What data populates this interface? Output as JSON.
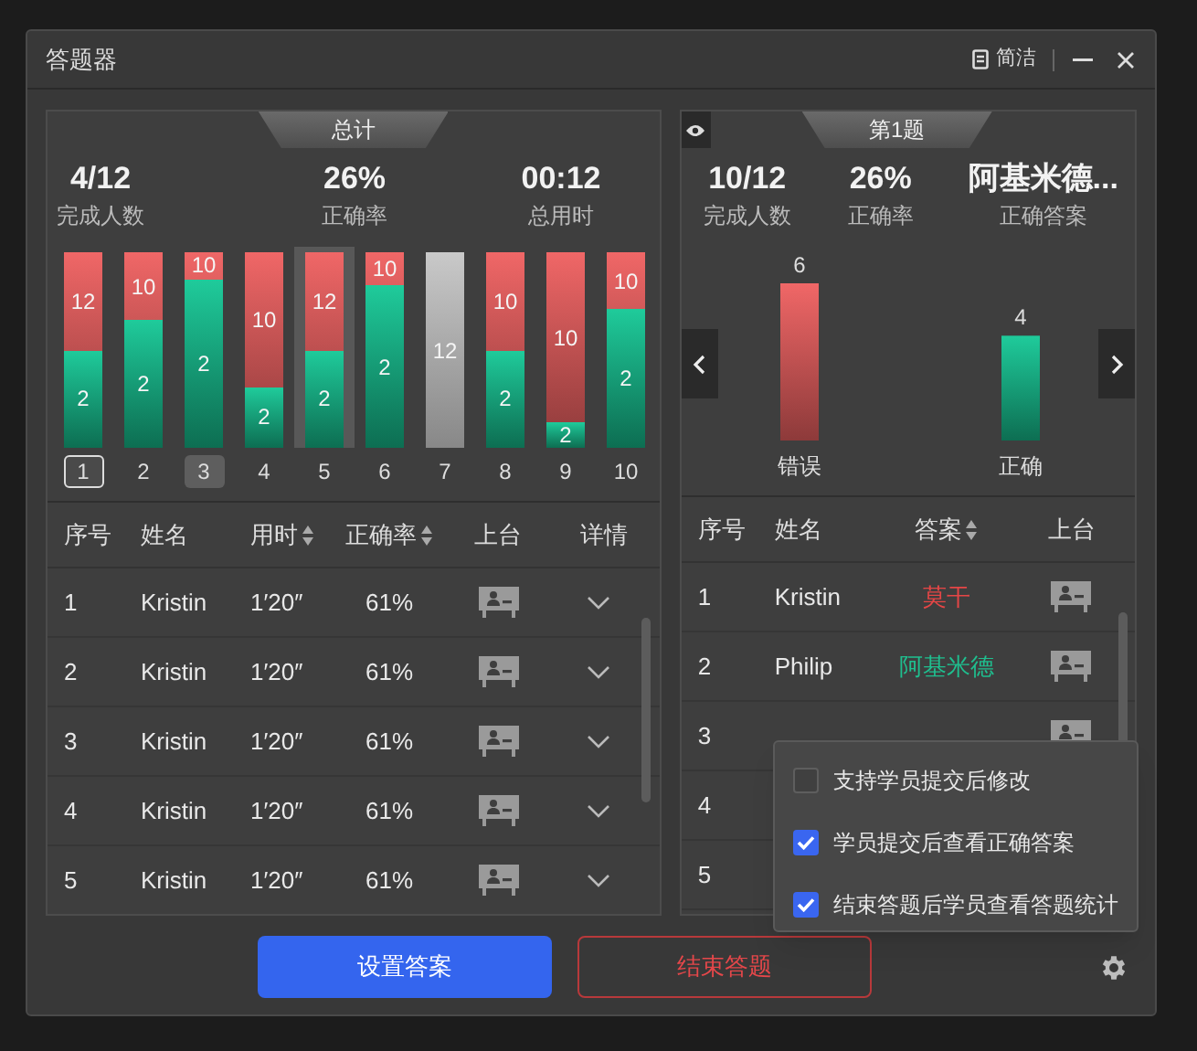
{
  "window": {
    "title": "答题器",
    "view_button": "简洁"
  },
  "summary": {
    "tab": "总计",
    "stats": [
      {
        "value": "4/12",
        "label": "完成人数"
      },
      {
        "value": "26%",
        "label": "正确率"
      },
      {
        "value": "00:12",
        "label": "总用时"
      }
    ],
    "questions": [
      {
        "number": "1",
        "kind": "split",
        "level": 0.5,
        "correct": "2",
        "wrong": "12",
        "current": true,
        "selected": false,
        "highlighted": false
      },
      {
        "number": "2",
        "kind": "split",
        "level": 0.65,
        "correct": "2",
        "wrong": "10",
        "current": false,
        "selected": false,
        "highlighted": false
      },
      {
        "number": "3",
        "kind": "split",
        "level": 0.86,
        "correct": "2",
        "wrong": "10",
        "current": false,
        "selected": true,
        "highlighted": false
      },
      {
        "number": "4",
        "kind": "split",
        "level": 0.31,
        "correct": "2",
        "wrong": "10",
        "current": false,
        "selected": false,
        "highlighted": false
      },
      {
        "number": "5",
        "kind": "split",
        "level": 0.5,
        "correct": "2",
        "wrong": "12",
        "current": false,
        "selected": false,
        "highlighted": true
      },
      {
        "number": "6",
        "kind": "split",
        "level": 0.83,
        "correct": "2",
        "wrong": "10",
        "current": false,
        "selected": false,
        "highlighted": false
      },
      {
        "number": "7",
        "kind": "unanswered",
        "total": "12",
        "current": false,
        "selected": false,
        "highlighted": false
      },
      {
        "number": "8",
        "kind": "split",
        "level": 0.5,
        "correct": "2",
        "wrong": "10",
        "current": false,
        "selected": false,
        "highlighted": false
      },
      {
        "number": "9",
        "kind": "split",
        "level": 0.13,
        "correct": "2",
        "wrong": "10",
        "current": false,
        "selected": false,
        "highlighted": false
      },
      {
        "number": "10",
        "kind": "split",
        "level": 0.71,
        "correct": "2",
        "wrong": "10",
        "current": false,
        "selected": false,
        "highlighted": false
      }
    ],
    "table": {
      "columns": [
        {
          "label": "序号",
          "sortable": false
        },
        {
          "label": "姓名",
          "sortable": false
        },
        {
          "label": "用时",
          "sortable": true
        },
        {
          "label": "正确率",
          "sortable": true
        },
        {
          "label": "上台",
          "sortable": false
        },
        {
          "label": "详情",
          "sortable": false
        }
      ],
      "rows": [
        {
          "number": "1",
          "name": "Kristin",
          "time": "1′20″",
          "rate": "61%"
        },
        {
          "number": "2",
          "name": "Kristin",
          "time": "1′20″",
          "rate": "61%"
        },
        {
          "number": "3",
          "name": "Kristin",
          "time": "1′20″",
          "rate": "61%"
        },
        {
          "number": "4",
          "name": "Kristin",
          "time": "1′20″",
          "rate": "61%"
        },
        {
          "number": "5",
          "name": "Kristin",
          "time": "1′20″",
          "rate": "61%"
        }
      ]
    }
  },
  "question": {
    "tab": "第1题",
    "stats": [
      {
        "value": "10/12",
        "label": "完成人数"
      },
      {
        "value": "26%",
        "label": "正确率"
      },
      {
        "value": "阿基米德...",
        "label": "正确答案"
      }
    ],
    "chart_data": {
      "type": "bar",
      "categories": [
        "错误",
        "正确"
      ],
      "values": [
        6,
        4
      ],
      "data_labels": true
    },
    "table": {
      "columns": [
        {
          "label": "序号",
          "sortable": false
        },
        {
          "label": "姓名",
          "sortable": false
        },
        {
          "label": "答案",
          "sortable": true
        },
        {
          "label": "上台",
          "sortable": false
        }
      ],
      "rows": [
        {
          "number": "1",
          "name": "Kristin",
          "answer": "莫干",
          "correct": false
        },
        {
          "number": "2",
          "name": "Philip",
          "answer": "阿基米德",
          "correct": true
        },
        {
          "number": "3"
        },
        {
          "number": "4"
        },
        {
          "number": "5"
        }
      ]
    }
  },
  "settings_menu": {
    "items": [
      {
        "label": "支持学员提交后修改",
        "checked": false
      },
      {
        "label": "学员提交后查看正确答案",
        "checked": true
      },
      {
        "label": "结束答题后学员查看答题统计",
        "checked": true
      }
    ]
  },
  "buttons": [
    {
      "label": "设置答案",
      "kind": "primary"
    },
    {
      "label": "结束答题",
      "kind": "danger"
    }
  ]
}
